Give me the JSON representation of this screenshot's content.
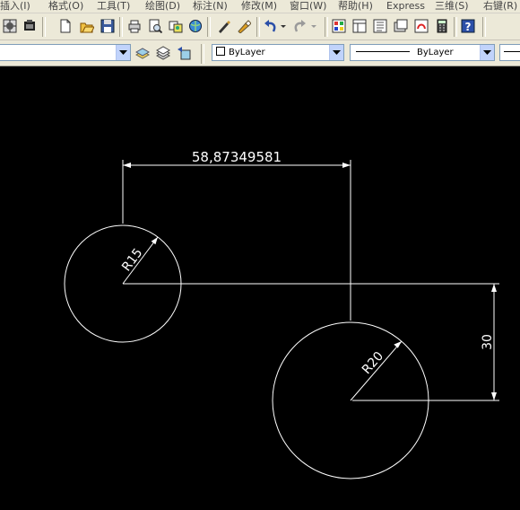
{
  "menu": {
    "items": [
      "插入(I)",
      "格式(O)",
      "工具(T)",
      "绘图(D)",
      "标注(N)",
      "修改(M)",
      "窗口(W)",
      "帮助(H)",
      "Express",
      "三维(S)",
      "右键(R)"
    ]
  },
  "layers": {
    "linetype_value": "ByLayer",
    "lineweight_value": "ByLayer"
  },
  "toolbar": {
    "icons": [
      "grid-icon",
      "snap-icon",
      "new-file-icon",
      "open-file-icon",
      "save-icon",
      "plot-icon",
      "preview-icon",
      "publish-icon",
      "3d-icon",
      "match-prop-icon",
      "highlighter-icon",
      "undo-icon",
      "redo-icon",
      "properties-icon",
      "design-center-icon",
      "tool-palette-icon",
      "sheet-set-icon",
      "markup-icon",
      "calculator-icon",
      "help-icon"
    ]
  },
  "drawing": {
    "colors": {
      "background": "#000000",
      "lines": "#ffffff"
    },
    "dimensions": {
      "horizontal": "58,87349581",
      "vertical": "30",
      "radius_small": "R15",
      "radius_large": "R20"
    }
  }
}
